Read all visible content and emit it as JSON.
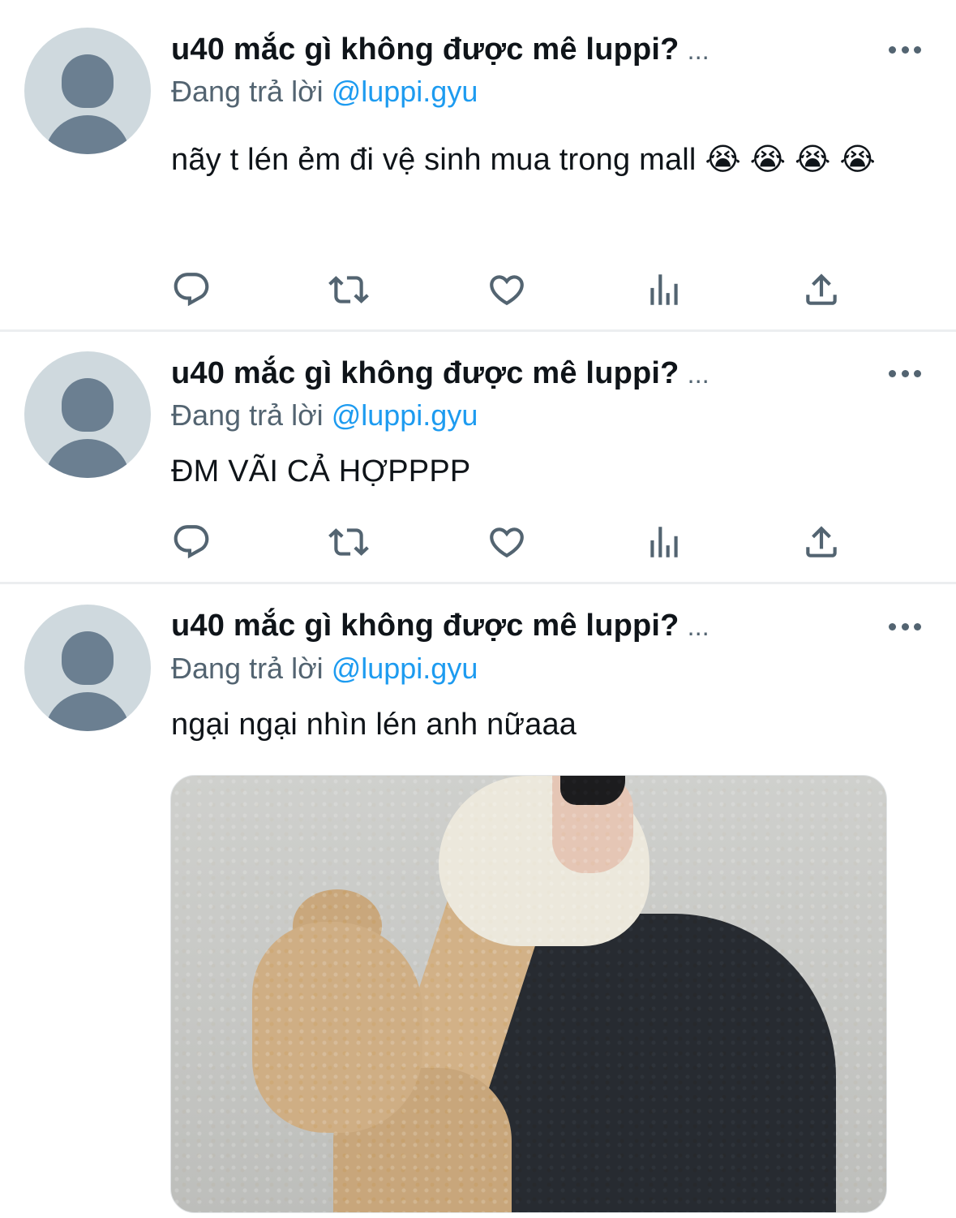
{
  "colors": {
    "text_primary": "#0f1419",
    "text_secondary": "#536471",
    "link": "#1d9bf0",
    "avatar_bg": "#cfd9de",
    "avatar_fg": "#6b7f91",
    "divider": "#eceef0"
  },
  "tweets": [
    {
      "author": "u40 mắc gì không được mê luppi?",
      "ellipsis": "...",
      "reply_prefix": "Đang trả lời",
      "reply_handle": "@luppi.gyu",
      "text": "nãy t lén ẻm đi vệ sinh mua trong mall 😭 😭 😭 😭",
      "actions": [
        "reply-icon",
        "retweet-icon",
        "like-icon",
        "analytics-icon",
        "share-icon"
      ]
    },
    {
      "author": "u40 mắc gì không được mê luppi?",
      "ellipsis": "...",
      "reply_prefix": "Đang trả lời",
      "reply_handle": "@luppi.gyu",
      "text": "ĐM VÃI CẢ HỢPPPP",
      "actions": [
        "reply-icon",
        "retweet-icon",
        "like-icon",
        "analytics-icon",
        "share-icon"
      ]
    },
    {
      "author": "u40 mắc gì không được mê luppi?",
      "ellipsis": "...",
      "reply_prefix": "Đang trả lời",
      "reply_handle": "@luppi.gyu",
      "text": "ngại ngại nhìn lén anh nữaaa",
      "media": "photo"
    }
  ]
}
